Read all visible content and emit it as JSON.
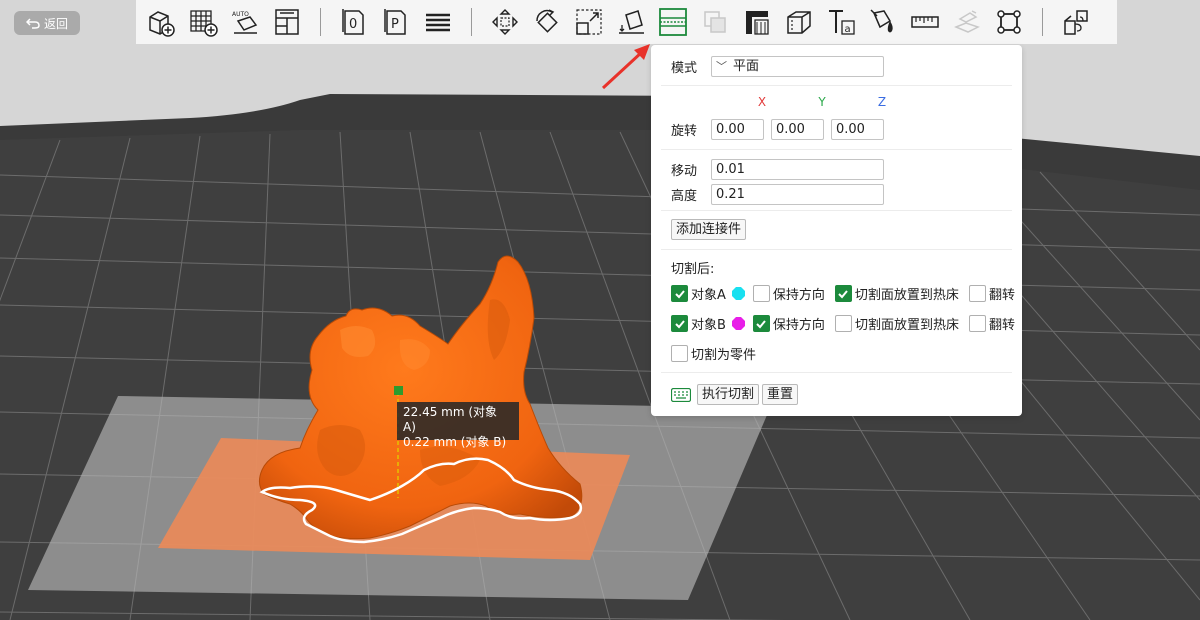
{
  "back": {
    "label": "返回",
    "icon": "undo-arrow-icon"
  },
  "toolbar": {
    "tools": [
      {
        "name": "add-cube-icon"
      },
      {
        "name": "add-grid-icon"
      },
      {
        "name": "auto-arrange-icon"
      },
      {
        "name": "layout-icon"
      },
      {
        "name": "plate-zero-icon"
      },
      {
        "name": "plate-p-icon"
      },
      {
        "name": "layers-icon"
      },
      {
        "name": "move-icon"
      },
      {
        "name": "rotate-icon"
      },
      {
        "name": "scale-icon"
      },
      {
        "name": "lay-on-face-icon"
      },
      {
        "name": "cut-icon",
        "active": true
      },
      {
        "name": "boolean-icon",
        "disabled": true
      },
      {
        "name": "support-icon"
      },
      {
        "name": "seam-icon"
      },
      {
        "name": "text-icon"
      },
      {
        "name": "paint-icon"
      },
      {
        "name": "measure-icon"
      },
      {
        "name": "assembly-icon",
        "disabled": true
      },
      {
        "name": "fit-view-icon"
      },
      {
        "name": "split-parts-icon"
      }
    ],
    "active_color": "#1c8a3c"
  },
  "panel": {
    "mode_label": "模式",
    "mode_value": "平面",
    "axis_x": "X",
    "axis_y": "Y",
    "axis_z": "Z",
    "rotate_label": "旋转",
    "rotate_x": "0.00",
    "rotate_y": "0.00",
    "rotate_z": "0.00",
    "move_label": "移动",
    "move_value": "0.01",
    "height_label": "高度",
    "height_value": "0.21",
    "add_connector": "添加连接件",
    "after_cut": "切割后:",
    "object_a": "对象A",
    "object_b": "对象B",
    "keep_orientation": "保持方向",
    "place_on_bed": "切割面放置到热床",
    "flip": "翻转",
    "cut_to_parts": "切割为零件",
    "perform_cut": "执行切割",
    "reset": "重置",
    "object_a_color": "#19e0f0",
    "object_b_color": "#e81ee8"
  },
  "measure": {
    "line1": "22.45  mm (对象 A)",
    "line2": "0.22  mm (对象 B)"
  }
}
